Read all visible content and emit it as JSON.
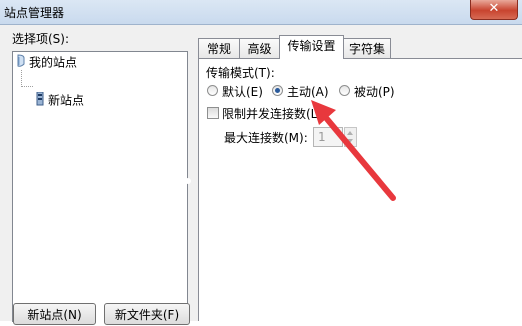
{
  "window": {
    "title": "站点管理器",
    "close_glyph": "✕"
  },
  "tree": {
    "label": "选择项(S):",
    "root": "我的站点",
    "child": "新站点"
  },
  "buttons": {
    "new_site": "新站点(N)",
    "new_folder": "新文件夹(F)"
  },
  "tabs": [
    {
      "label": "常规",
      "active": false
    },
    {
      "label": "高级",
      "active": false
    },
    {
      "label": "传输设置",
      "active": true
    },
    {
      "label": "字符集",
      "active": false
    }
  ],
  "transfer": {
    "mode_label": "传输模式(T):",
    "modes": [
      {
        "label": "默认(E)",
        "checked": false
      },
      {
        "label": "主动(A)",
        "checked": true
      },
      {
        "label": "被动(P)",
        "checked": false
      }
    ],
    "limit_label": "限制并发连接数(L)",
    "limit_checked": false,
    "max_label": "最大连接数(M):",
    "max_value": "1"
  },
  "colors": {
    "annotation_arrow": "#e8383d"
  }
}
